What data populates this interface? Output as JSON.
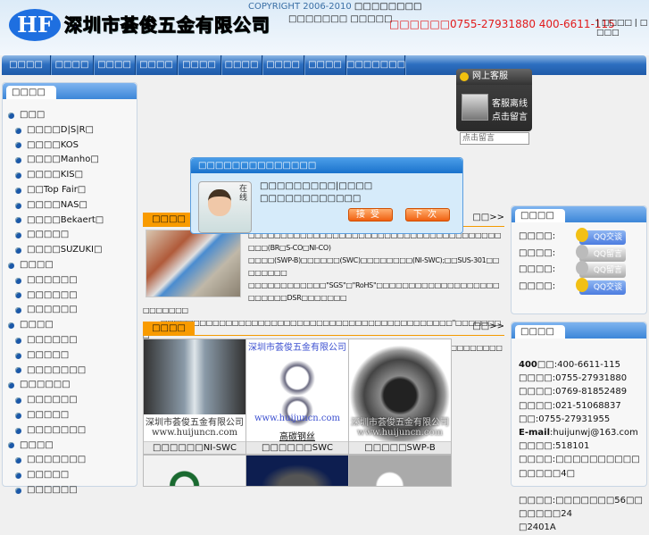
{
  "header": {
    "logo_mark": "HF",
    "company_name": "深圳市荟俊五金有限公司",
    "copyright": "COPYRIGHT 2006-2010",
    "copyright_suffix": "□□□□□□□□",
    "subtitle": "□□□□□□□ □□□□□",
    "phone": "□□□□□□0755-27931880 400-6611-115",
    "links": [
      "□□□□",
      "□□□□"
    ]
  },
  "nav": [
    "□□□□",
    "□□□□",
    "□□□□",
    "□□□□",
    "□□□□",
    "□□□□",
    "□□□□",
    "□□□□",
    "□□□□□□□"
  ],
  "left": {
    "title": "□□□□",
    "items": [
      {
        "label": "□□□",
        "sub": false
      },
      {
        "label": "□□□□D|S|R□",
        "sub": true
      },
      {
        "label": "□□□□KOS",
        "sub": true
      },
      {
        "label": "□□□□Manho□",
        "sub": true
      },
      {
        "label": "□□□□KIS□",
        "sub": true
      },
      {
        "label": "□□Top Fair□",
        "sub": true
      },
      {
        "label": "□□□□NAS□",
        "sub": true
      },
      {
        "label": "□□□□Bekaert□",
        "sub": true
      },
      {
        "label": "□□□□□",
        "sub": true
      },
      {
        "label": "□□□□SUZUKI□",
        "sub": true
      },
      {
        "label": "□□□□",
        "sub": false
      },
      {
        "label": "□□□□□□",
        "sub": true
      },
      {
        "label": "□□□□□□",
        "sub": true
      },
      {
        "label": "□□□□□□",
        "sub": true
      },
      {
        "label": "□□□□",
        "sub": false
      },
      {
        "label": "□□□□□□",
        "sub": true
      },
      {
        "label": "□□□□□",
        "sub": true
      },
      {
        "label": "□□□□□□□",
        "sub": true
      },
      {
        "label": "□□□□□□",
        "sub": false
      },
      {
        "label": "□□□□□□",
        "sub": true
      },
      {
        "label": "□□□□□",
        "sub": true
      },
      {
        "label": "□□□□□□□",
        "sub": true
      },
      {
        "label": "□□□□",
        "sub": false
      },
      {
        "label": "□□□□□□□",
        "sub": true
      },
      {
        "label": "□□□□□",
        "sub": true
      },
      {
        "label": "□□□□□□",
        "sub": true
      }
    ]
  },
  "kf": {
    "title": "网上客服",
    "line1": "客服离线",
    "line2": "点击留言",
    "input_placeholder": "点击留言"
  },
  "popup": {
    "title": "□□□□□□□□□□□□□□",
    "online": "在线",
    "msg1": "□□□□□□□□□|□□□□",
    "msg2": "□□□□□□□□□□□□",
    "accept": "接受",
    "next": "下次"
  },
  "about": {
    "title": "□□□□",
    "more": "□□>>",
    "lines": [
      "□□□□□□□□□□□□□□□□□□□□□□□□□□□□□□□□□□□□□□□□□□(BR□S-CO□NI-CO)",
      "□□□□(SWP-B)□□□□□□(SWC)□□□□□□□□(NI-SWC);□□SUS-301□□□□□□□□",
      "□□□□□□□□□□□□\"SGS\"□\"RoHS\"□□□□□□□□□□□□□□□□□□□□□□□□□DSR□□□□□□□",
      "□□□□□□□"
    ],
    "para2_line1": "□□□□□□□□□□□□□□□□□□□□□□□□□□□□□□□□□□□□□□□□□□□□□\"□□□□□□□□",
    "para2_line2": "□□□□□□□□□□□□□□□\"□□□□□□□□□□□□□□□□□□□□□□□□□□□□□□□□□□□□□□□□□□□□□□□□□□□□□□□□□□□□□□□□□□"
  },
  "products": {
    "title": "□□□□",
    "more": "□□>>",
    "watermark_company": "深圳市荟俊五金有限公司",
    "watermark_url": "www.huijuncn.com",
    "items": [
      {
        "caption": "□□□□□□NI-SWC",
        "img_label": ""
      },
      {
        "caption": "□□□□□□SWC",
        "img_label": "高碳钢丝"
      },
      {
        "caption": "□□□□□SWP-B",
        "img_label": ""
      }
    ]
  },
  "qq_panel": {
    "title": "□□□□",
    "rows": [
      {
        "label": "□□□□:",
        "button": "QQ交谈",
        "online": true
      },
      {
        "label": "□□□□:",
        "button": "QQ留言",
        "online": false
      },
      {
        "label": "□□□□:",
        "button": "QQ留言",
        "online": false
      },
      {
        "label": "□□□□:",
        "button": "QQ交谈",
        "online": true
      }
    ]
  },
  "contact": {
    "title": "□□□□",
    "lines": [
      {
        "k": "400□□",
        "v": ":400-6611-115",
        "bold": true
      },
      {
        "k": "□□□□",
        "v": ":0755-27931880"
      },
      {
        "k": "□□□□",
        "v": ":0769-81852489"
      },
      {
        "k": "□□□□",
        "v": ":021-51068837"
      },
      {
        "k": "□□",
        "v": ":0755-27931955"
      },
      {
        "k": "E-mail",
        "v": ":huijunwj@163.com",
        "bold": true
      },
      {
        "k": "□□□□",
        "v": ":518101"
      },
      {
        "k": "□□□□",
        "v": ":□□□□□□□□□□□□□□□4□"
      },
      {
        "k": "",
        "v": ""
      },
      {
        "k": "□□□□",
        "v": ":□□□□□□□56□□□□□□□24"
      },
      {
        "k": "",
        "v": "□2401A"
      }
    ]
  },
  "colors": {
    "nav": "#1f5aa8",
    "accent_orange": "#f99b00",
    "phone_red": "#e21b1b"
  }
}
